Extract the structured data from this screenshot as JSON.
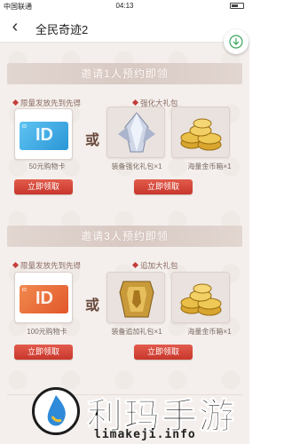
{
  "status_bar": {
    "carrier": "中国联通",
    "time": "04:13"
  },
  "nav": {
    "title": "全民奇迹2"
  },
  "sections": [
    {
      "banner": "邀请1人预约即领",
      "label_left": "限量发放先到先得",
      "label_right": "强化大礼包",
      "or_text": "或",
      "items": [
        {
          "caption": "50元购物卡",
          "icon": "blue-id-card-icon"
        },
        {
          "caption": "装备强化礼包×1",
          "icon": "silver-crystal-icon"
        },
        {
          "caption": "海量金币箱×1",
          "icon": "gold-coins-icon"
        }
      ],
      "button_label": "立即领取"
    },
    {
      "banner": "邀请3人预约即领",
      "label_left": "限量发放先到先得",
      "label_right": "追加大礼包",
      "or_text": "或",
      "items": [
        {
          "caption": "100元购物卡",
          "icon": "orange-id-card-icon"
        },
        {
          "caption": "装备追加礼包×1",
          "icon": "golden-armor-icon"
        },
        {
          "caption": "海量金币箱×1",
          "icon": "gold-coins-icon"
        }
      ],
      "button_label": "立即领取"
    }
  ],
  "watermark": {
    "name": "利玛手游",
    "url": "limakeji.info"
  }
}
